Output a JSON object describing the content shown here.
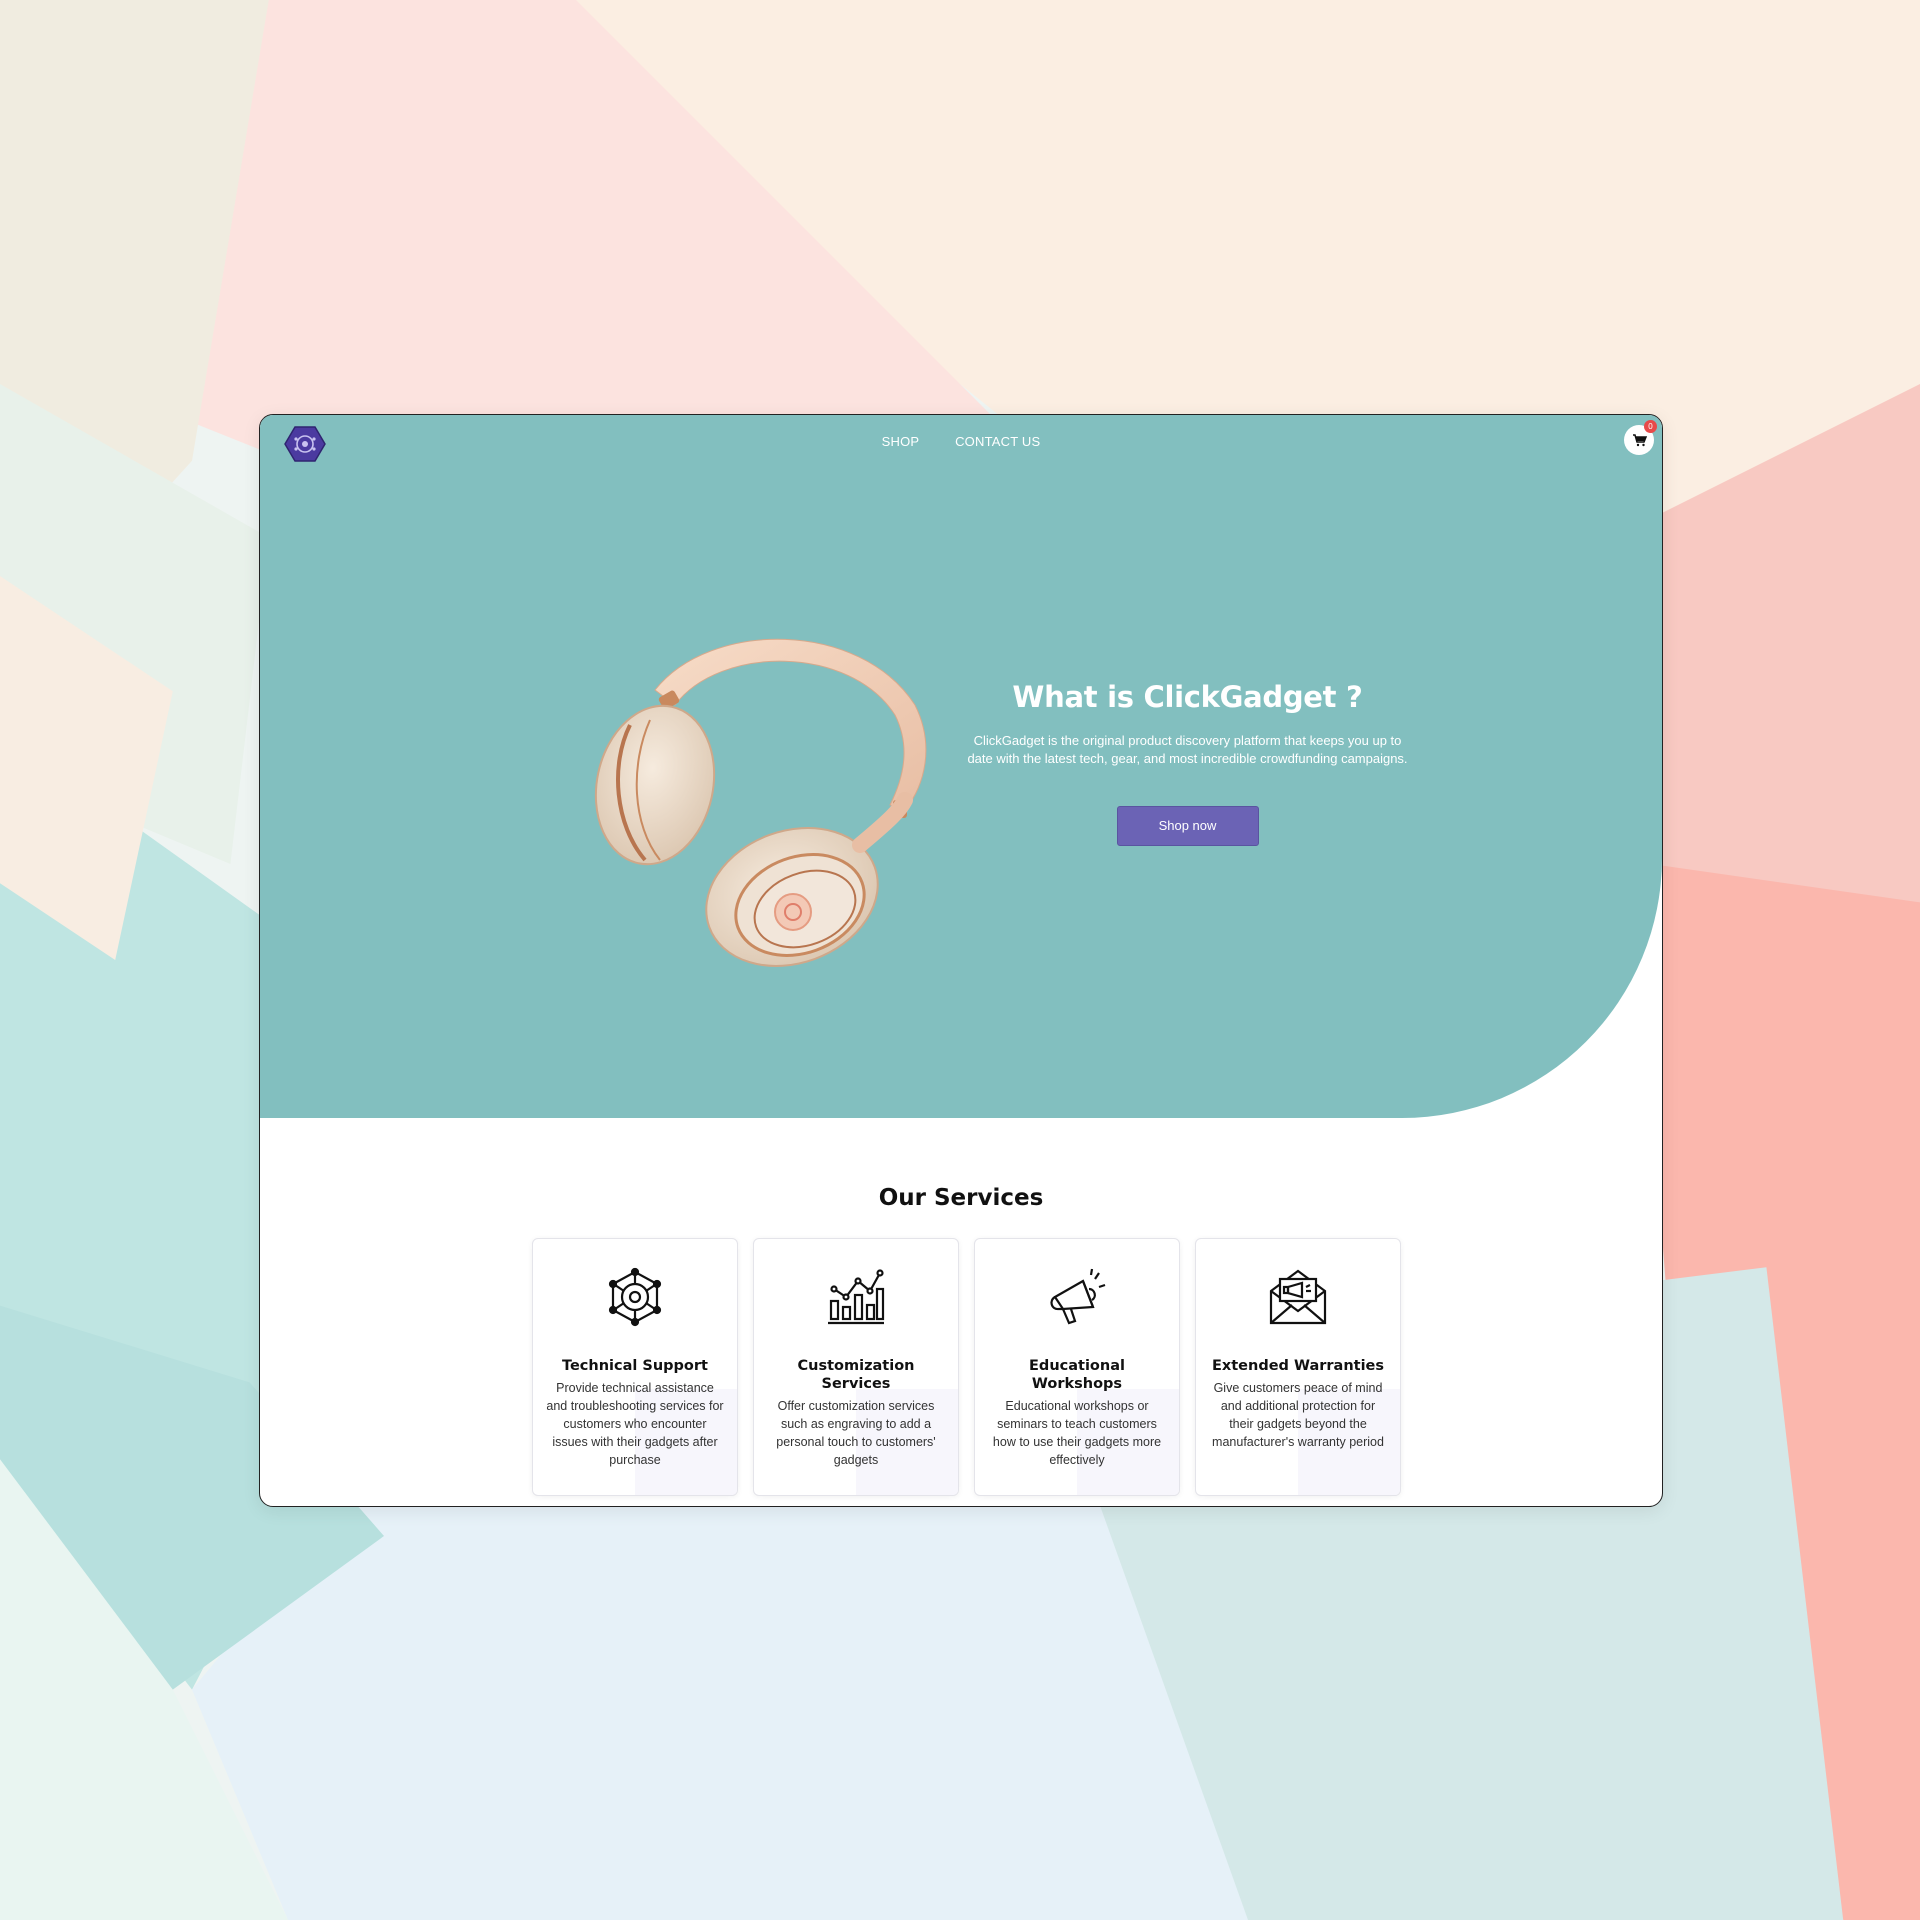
{
  "nav": {
    "links": [
      "SHOP",
      "CONTACT US"
    ],
    "cart_count": "0"
  },
  "hero": {
    "title": "What is ClickGadget ?",
    "description": "ClickGadget is the original product discovery platform that keeps you up to date with the latest tech, gear, and most incredible crowdfunding campaigns.",
    "cta_label": "Shop now"
  },
  "services": {
    "title": "Our Services",
    "cards": [
      {
        "title": "Technical Support",
        "description": "Provide technical assistance and troubleshooting services for customers who encounter issues with their gadgets after purchase",
        "icon": "network-gear-icon"
      },
      {
        "title": "Customization Services",
        "description": "Offer customization services such as engraving to add a personal touch to customers' gadgets",
        "icon": "bar-chart-icon"
      },
      {
        "title": "Educational Workshops",
        "description": "Educational workshops or seminars to teach customers how to use their gadgets more effectively",
        "icon": "megaphone-icon"
      },
      {
        "title": "Extended Warranties",
        "description": "Give customers peace of mind and additional protection for their gadgets beyond the manufacturer's warranty period",
        "icon": "envelope-megaphone-icon"
      }
    ]
  },
  "colors": {
    "hero_bg": "#82bfbf",
    "cta_bg": "#6b63b5",
    "logo": "#4b3aa0",
    "cart_badge": "#e84a4a"
  }
}
